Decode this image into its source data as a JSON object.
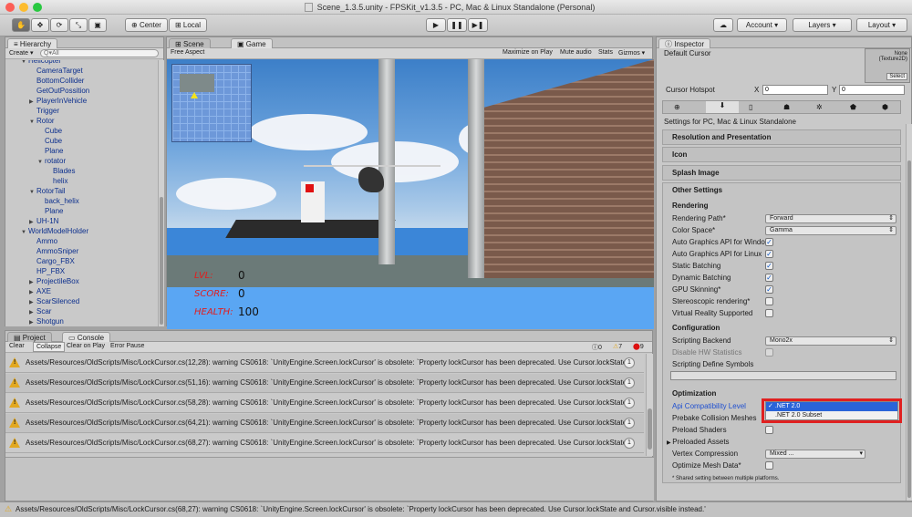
{
  "window": {
    "title": "Scene_1.3.5.unity - FPSKit_v1.3.5 - PC, Mac & Linux Standalone (Personal)"
  },
  "toolbar": {
    "center_label": "Center",
    "local_label": "Local",
    "account_label": "Account",
    "layers_label": "Layers",
    "layout_label": "Layout"
  },
  "hierarchy": {
    "tab_label": "Hierarchy",
    "create_label": "Create",
    "search_placeholder": "Q▾All",
    "items": [
      {
        "label": "Helicopter",
        "depth": 1,
        "arrow": "▼"
      },
      {
        "label": "CameraTarget",
        "depth": 2,
        "arrow": ""
      },
      {
        "label": "BottomCollider",
        "depth": 2,
        "arrow": ""
      },
      {
        "label": "GetOutPossition",
        "depth": 2,
        "arrow": ""
      },
      {
        "label": "PlayerInVehicle",
        "depth": 2,
        "arrow": "▶"
      },
      {
        "label": "Trigger",
        "depth": 2,
        "arrow": ""
      },
      {
        "label": "Rotor",
        "depth": 2,
        "arrow": "▼"
      },
      {
        "label": "Cube",
        "depth": 3,
        "arrow": ""
      },
      {
        "label": "Cube",
        "depth": 3,
        "arrow": ""
      },
      {
        "label": "Plane",
        "depth": 3,
        "arrow": ""
      },
      {
        "label": "rotator",
        "depth": 3,
        "arrow": "▼"
      },
      {
        "label": "Blades",
        "depth": 4,
        "arrow": ""
      },
      {
        "label": "helix",
        "depth": 4,
        "arrow": ""
      },
      {
        "label": "RotorTail",
        "depth": 2,
        "arrow": "▼"
      },
      {
        "label": "back_helix",
        "depth": 3,
        "arrow": ""
      },
      {
        "label": "Plane",
        "depth": 3,
        "arrow": ""
      },
      {
        "label": "UH-1N",
        "depth": 2,
        "arrow": "▶"
      },
      {
        "label": "WorldModelHolder",
        "depth": 1,
        "arrow": "▼"
      },
      {
        "label": "Ammo",
        "depth": 2,
        "arrow": ""
      },
      {
        "label": "AmmoSniper",
        "depth": 2,
        "arrow": ""
      },
      {
        "label": "Cargo_FBX",
        "depth": 2,
        "arrow": ""
      },
      {
        "label": "HP_FBX",
        "depth": 2,
        "arrow": ""
      },
      {
        "label": "ProjectileBox",
        "depth": 2,
        "arrow": "▶"
      },
      {
        "label": "AXE",
        "depth": 2,
        "arrow": "▶"
      },
      {
        "label": "ScarSilenced",
        "depth": 2,
        "arrow": "▶"
      },
      {
        "label": "Scar",
        "depth": 2,
        "arrow": "▶"
      },
      {
        "label": "Shotgun",
        "depth": 2,
        "arrow": "▶"
      }
    ]
  },
  "game": {
    "scene_tab": "Scene",
    "game_tab": "Game",
    "aspect_label": "Free Aspect",
    "maximize_label": "Maximize on Play",
    "mute_label": "Mute audio",
    "stats_label": "Stats",
    "gizmos_label": "Gizmos ▾",
    "hud": {
      "lvl_label": "LVL:",
      "lvl_value": "0",
      "score_label": "SCORE:",
      "score_value": "0",
      "health_label": "HEALTH:",
      "health_value": "100"
    }
  },
  "console": {
    "project_tab": "Project",
    "console_tab": "Console",
    "clear_label": "Clear",
    "collapse_label": "Collapse",
    "clear_on_play_label": "Clear on Play",
    "error_pause_label": "Error Pause",
    "info_count": "0",
    "warn_count": "7",
    "error_count": "9",
    "messages": [
      {
        "text": "Assets/Resources/OldScripts/Misc/LockCursor.cs(12,28): warning CS0618: `UnityEngine.Screen.lockCursor' is obsolete: `Property lockCursor has been deprecated. Use Cursor.lockState and",
        "count": "1"
      },
      {
        "text": "Assets/Resources/OldScripts/Misc/LockCursor.cs(51,16): warning CS0618: `UnityEngine.Screen.lockCursor' is obsolete: `Property lockCursor has been deprecated. Use Cursor.lockState and",
        "count": "1"
      },
      {
        "text": "Assets/Resources/OldScripts/Misc/LockCursor.cs(58,28): warning CS0618: `UnityEngine.Screen.lockCursor' is obsolete: `Property lockCursor has been deprecated. Use Cursor.lockState and",
        "count": "1"
      },
      {
        "text": "Assets/Resources/OldScripts/Misc/LockCursor.cs(64,21): warning CS0618: `UnityEngine.Screen.lockCursor' is obsolete: `Property lockCursor has been deprecated. Use Cursor.lockState and",
        "count": "1"
      },
      {
        "text": "Assets/Resources/OldScripts/Misc/LockCursor.cs(68,27): warning CS0618: `UnityEngine.Screen.lockCursor' is obsolete: `Property lockCursor has been deprecated. Use Cursor.lockState and",
        "count": "1"
      }
    ]
  },
  "inspector": {
    "tab_label": "Inspector",
    "default_cursor_label": "Default Cursor",
    "none_texture": "None (Texture2D)",
    "select_label": "Select",
    "cursor_hotspot_label": "Cursor Hotspot",
    "x_label": "X",
    "x_value": "0",
    "y_label": "Y",
    "y_value": "0",
    "settings_for": "Settings for PC, Mac & Linux Standalone",
    "resolution_label": "Resolution and Presentation",
    "icon_label": "Icon",
    "splash_label": "Splash Image",
    "other_label": "Other Settings",
    "rendering_label": "Rendering",
    "rendering_path_label": "Rendering Path*",
    "rendering_path_value": "Forward",
    "color_space_label": "Color Space*",
    "color_space_value": "Gamma",
    "auto_win_label": "Auto Graphics API for Windo",
    "auto_linux_label": "Auto Graphics API for Linux",
    "static_batching_label": "Static Batching",
    "dynamic_batching_label": "Dynamic Batching",
    "gpu_skinning_label": "GPU Skinning*",
    "stereo_label": "Stereoscopic rendering*",
    "vr_label": "Virtual Reality Supported",
    "configuration_label": "Configuration",
    "scripting_backend_label": "Scripting Backend",
    "scripting_backend_value": "Mono2x",
    "disable_hw_label": "Disable HW Statistics",
    "define_symbols_label": "Scripting Define Symbols",
    "optimization_label": "Optimization",
    "api_compat_label": "Api Compatibility Level",
    "api_option_1": ".NET 2.0",
    "api_option_2": ".NET 2.0 Subset",
    "check_mark": "✓",
    "prebake_label": "Prebake Collision Meshes",
    "preload_shaders_label": "Preload Shaders",
    "preloaded_assets_label": "Preloaded Assets",
    "vertex_compression_label": "Vertex Compression",
    "vertex_compression_value": "Mixed ...",
    "optimize_mesh_label": "Optimize Mesh Data*",
    "shared_note": "* Shared setting between multiple platforms."
  },
  "statusbar": {
    "text": "Assets/Resources/OldScripts/Misc/LockCursor.cs(68,27): warning CS0618: `UnityEngine.Screen.lockCursor' is obsolete: `Property lockCursor has been deprecated. Use Cursor.lockState and Cursor.visible instead.'"
  }
}
